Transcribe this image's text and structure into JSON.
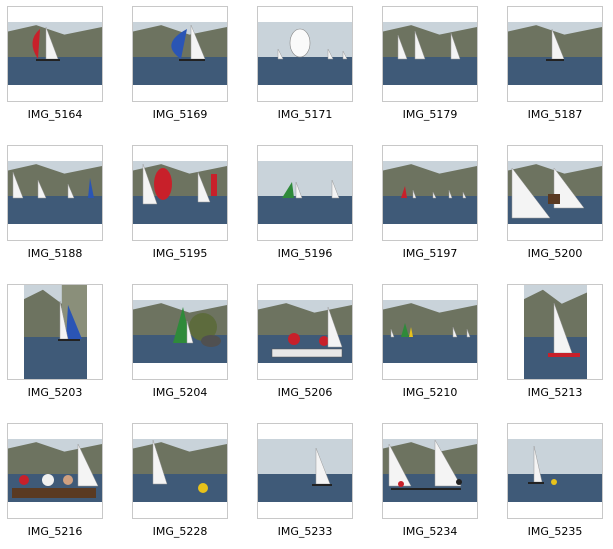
{
  "thumbnails": [
    {
      "name": "IMG_5164",
      "orientation": "landscape",
      "scene": "red-sail-harbor"
    },
    {
      "name": "IMG_5169",
      "orientation": "landscape",
      "scene": "blue-spinnaker"
    },
    {
      "name": "IMG_5171",
      "orientation": "landscape",
      "scene": "white-spinnaker-haze"
    },
    {
      "name": "IMG_5179",
      "orientation": "landscape",
      "scene": "three-sails-cliff"
    },
    {
      "name": "IMG_5187",
      "orientation": "landscape",
      "scene": "single-sail-village"
    },
    {
      "name": "IMG_5188",
      "orientation": "landscape",
      "scene": "fleet-mountains"
    },
    {
      "name": "IMG_5195",
      "orientation": "landscape",
      "scene": "red-spinnaker-pair"
    },
    {
      "name": "IMG_5196",
      "orientation": "landscape",
      "scene": "green-sail-haze"
    },
    {
      "name": "IMG_5197",
      "orientation": "landscape",
      "scene": "distant-fleet-red"
    },
    {
      "name": "IMG_5200",
      "orientation": "landscape",
      "scene": "close-up-crew"
    },
    {
      "name": "IMG_5203",
      "orientation": "portrait",
      "scene": "blue-sail-cliff"
    },
    {
      "name": "IMG_5204",
      "orientation": "landscape",
      "scene": "green-sail-rocks"
    },
    {
      "name": "IMG_5206",
      "orientation": "landscape",
      "scene": "motorboat-crew"
    },
    {
      "name": "IMG_5210",
      "orientation": "landscape",
      "scene": "small-fleet-green"
    },
    {
      "name": "IMG_5213",
      "orientation": "portrait",
      "scene": "white-sail-portrait"
    },
    {
      "name": "IMG_5216",
      "orientation": "landscape",
      "scene": "spectator-boat"
    },
    {
      "name": "IMG_5228",
      "orientation": "landscape",
      "scene": "yellow-buoy"
    },
    {
      "name": "IMG_5233",
      "orientation": "landscape",
      "scene": "lone-sail-haze"
    },
    {
      "name": "IMG_5234",
      "orientation": "landscape",
      "scene": "two-boats-crew"
    },
    {
      "name": "IMG_5235",
      "orientation": "landscape",
      "scene": "small-sail-distance"
    }
  ],
  "colors": {
    "sky": "#c9d3da",
    "water": "#3f5a78",
    "mountain": "#6d7360",
    "sail": "#f4f4f4",
    "red": "#c8202a",
    "blue": "#2a55b5",
    "green": "#2f8a3a",
    "yellow": "#e8c21a"
  }
}
